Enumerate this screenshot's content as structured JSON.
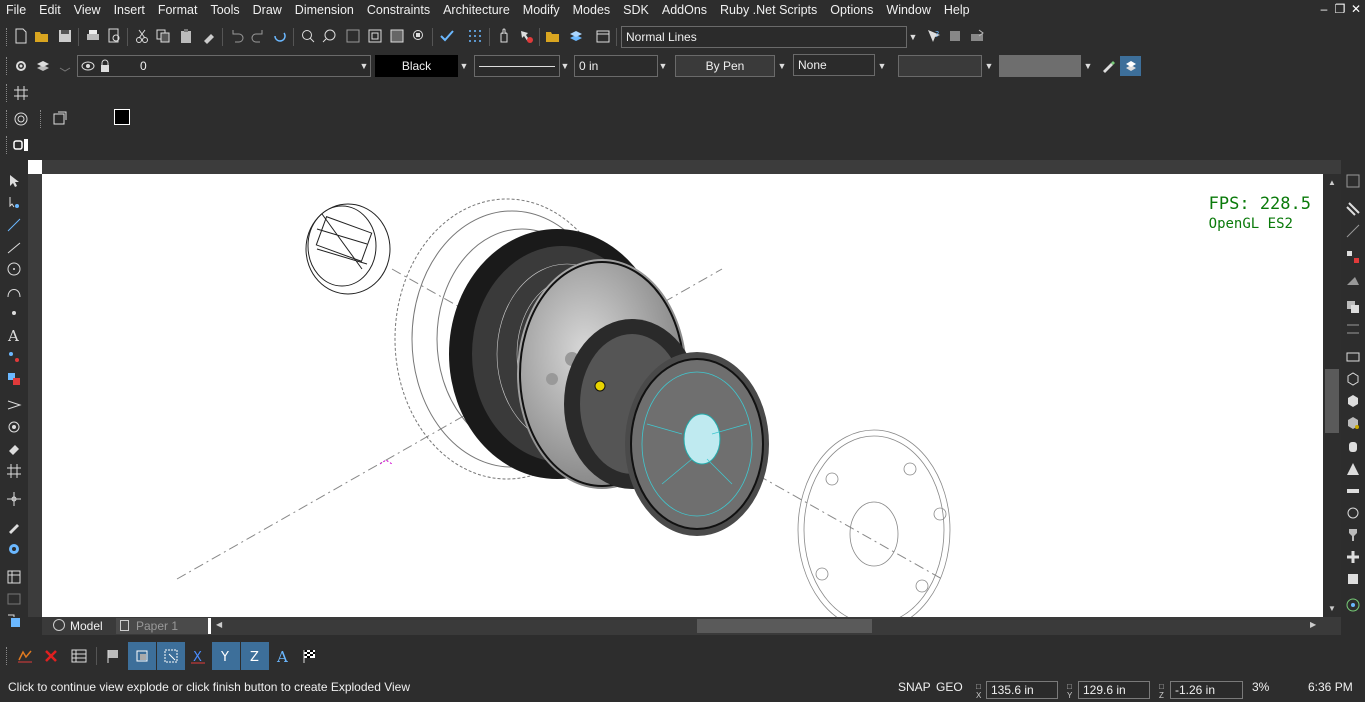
{
  "menu": [
    "File",
    "Edit",
    "View",
    "Insert",
    "Format",
    "Tools",
    "Draw",
    "Dimension",
    "Constraints",
    "Architecture",
    "Modify",
    "Modes",
    "SDK",
    "AddOns",
    "Ruby .Net Scripts",
    "Options",
    "Window",
    "Help"
  ],
  "toolbar": {
    "linestyle_combo": "Normal Lines",
    "layer_combo": "0",
    "color_combo": "Black",
    "width_combo": "0 in",
    "pen_combo": "By Pen",
    "fill_combo": "None"
  },
  "viewport": {
    "fps_label": "FPS: 228.5",
    "renderer_label": "OpenGL ES2"
  },
  "tabs": [
    "Model",
    "Paper 1"
  ],
  "status": {
    "prompt": "Click to continue view explode or click finish button to create Exploded View",
    "snap": "SNAP",
    "geo": "GEO",
    "x_label": "X",
    "y_label": "Y",
    "z_label": "Z",
    "x_value": "135.6 in",
    "y_value": "129.6 in",
    "z_value": "-1.26 in",
    "zoom": "3%",
    "time": "6:36 PM"
  },
  "colors": {
    "background": "#2d2d2d",
    "canvas": "#ffffff",
    "fps_text": "#0a7a0a",
    "accent": "#4aa8e0"
  }
}
